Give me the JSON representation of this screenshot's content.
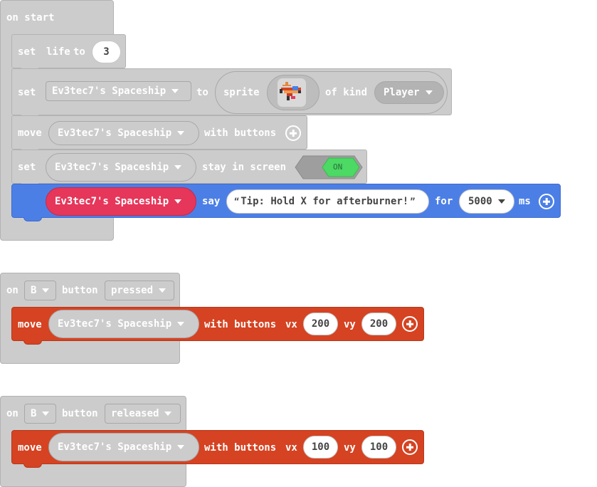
{
  "on_start": {
    "hat_label": "on start",
    "set_life": {
      "set": "set",
      "target": "life",
      "to": "to",
      "value": "3"
    },
    "set_sprite": {
      "set": "set",
      "variable": "Ev3tec7's Spaceship",
      "to": "to",
      "sprite": "sprite",
      "of_kind": "of kind",
      "kind": "Player"
    },
    "move_buttons": {
      "move": "move",
      "sprite": "Ev3tec7's Spaceship",
      "with_buttons": "with buttons"
    },
    "stay_in_screen": {
      "set": "set",
      "sprite": "Ev3tec7's Spaceship",
      "label": "stay in screen",
      "toggle": "ON"
    },
    "say": {
      "sprite": "Ev3tec7's Spaceship",
      "say": "say",
      "text": "Tip: Hold X for afterburner!",
      "open_quote": "“",
      "close_quote": "”",
      "for": "for",
      "duration": "5000",
      "ms": "ms"
    }
  },
  "on_b_pressed": {
    "on": "on",
    "button": "B",
    "button_word": "button",
    "event": "pressed",
    "move": {
      "move": "move",
      "sprite": "Ev3tec7's Spaceship",
      "with_buttons": "with buttons",
      "vx_label": "vx",
      "vx": "200",
      "vy_label": "vy",
      "vy": "200"
    }
  },
  "on_b_released": {
    "on": "on",
    "button": "B",
    "button_word": "button",
    "event": "released",
    "move": {
      "move": "move",
      "sprite": "Ev3tec7's Spaceship",
      "with_buttons": "with buttons",
      "vx_label": "vx",
      "vx": "100",
      "vy_label": "vy",
      "vy": "100"
    }
  },
  "colors": {
    "hat_gray": "#cccccc",
    "sprites_blue": "#4c7fe6",
    "controller_red": "#d54322",
    "sprite_var_pink": "#e6365a",
    "toggle_on_green": "#4cd964"
  }
}
